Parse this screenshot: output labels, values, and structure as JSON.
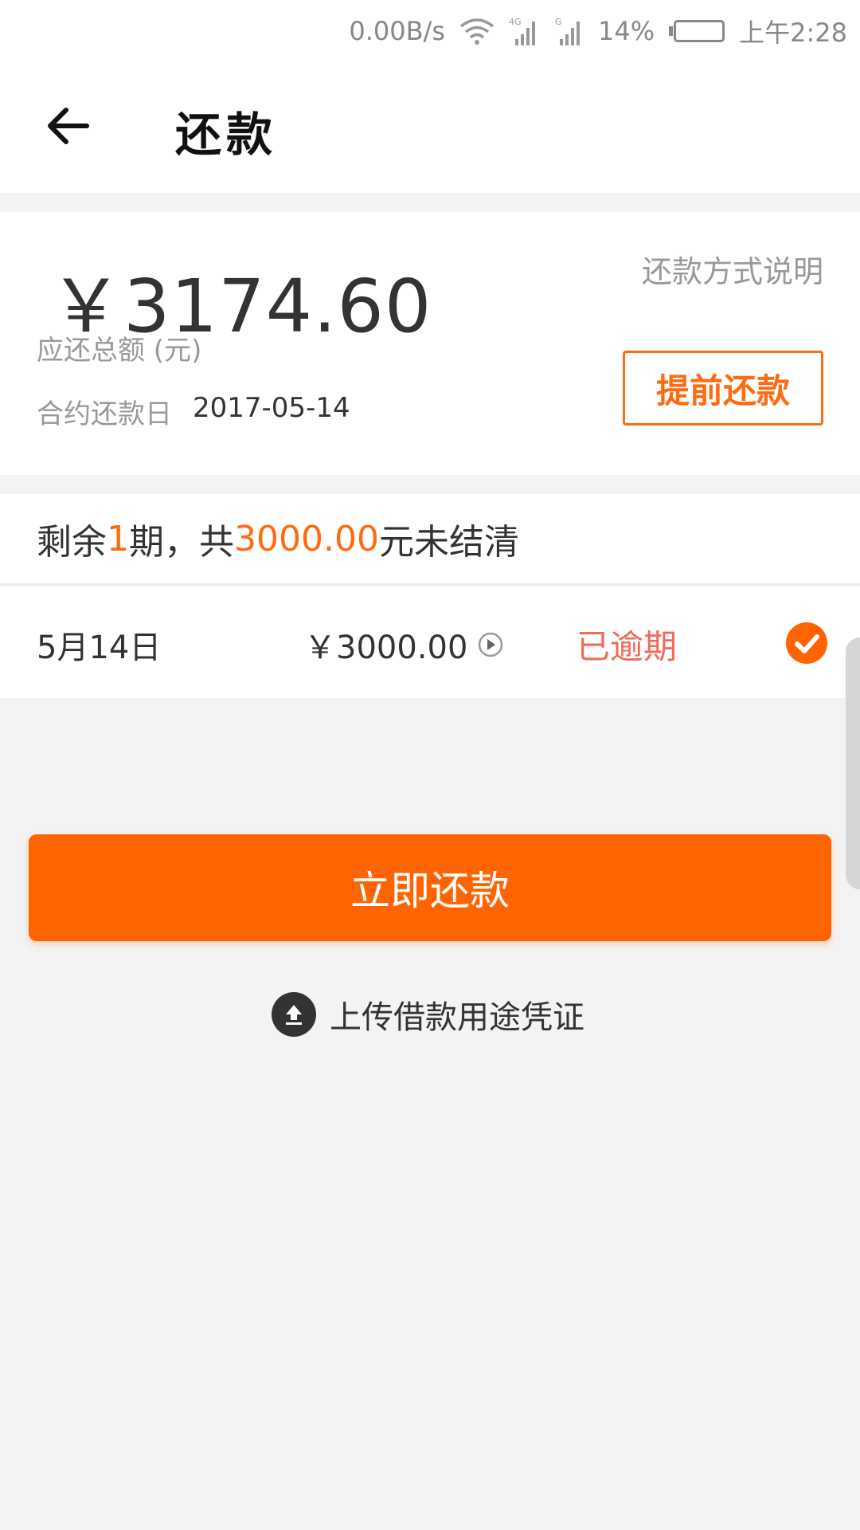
{
  "status_bar": {
    "speed": "0.00B/s",
    "network_label": "4G",
    "battery_percent": "14%",
    "battery_level": 0.86,
    "time": "上午2:28"
  },
  "header": {
    "title": "还款",
    "back_icon": "arrow-left-icon"
  },
  "summary": {
    "amount": "￥3174.60",
    "amount_label": "应还总额 (元)",
    "due_label": "合约还款日",
    "due_date": "2017-05-14",
    "explain_link": "还款方式说明",
    "prepay_button": "提前还款"
  },
  "remaining": {
    "prefix": "剩余",
    "periods": "1",
    "middle": "期，共",
    "amount": "3000.00",
    "suffix": "元未结清"
  },
  "installments": [
    {
      "date": "5月14日",
      "amount": "￥3000.00",
      "status": "已逾期",
      "checked": true
    }
  ],
  "actions": {
    "pay_now": "立即还款",
    "upload": "上传借款用途凭证"
  },
  "colors": {
    "accent": "#ff6400",
    "overdue": "#f06a5a"
  }
}
